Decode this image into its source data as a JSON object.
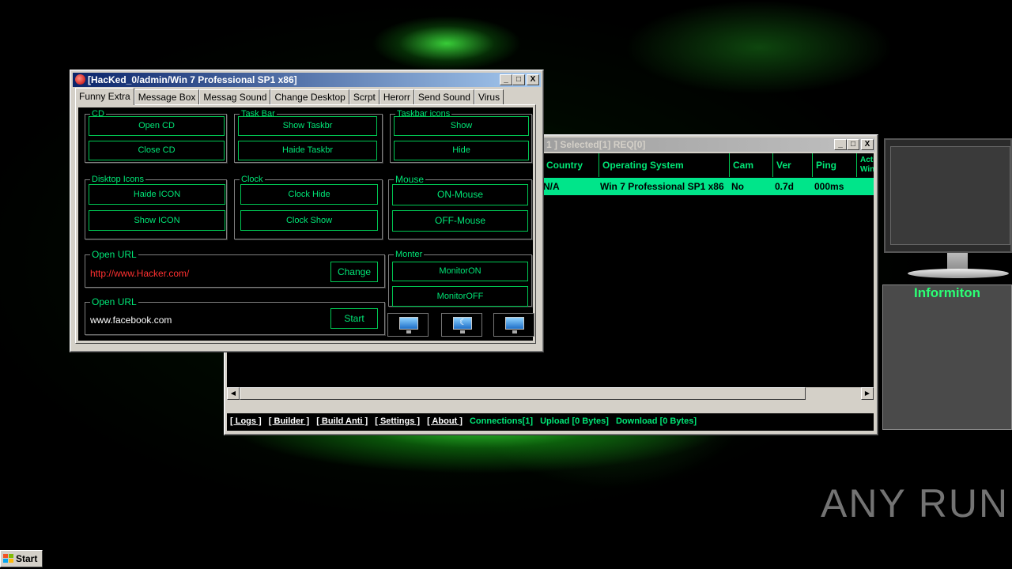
{
  "colors": {
    "accent_green": "#00e676",
    "selected_row": "#00e58a",
    "url_red": "#ff3030"
  },
  "main_window": {
    "title": "[HacKed_0/admin/Win 7 Professional SP1 x86]",
    "buttons": [
      "_",
      "□",
      "X"
    ],
    "tabs": [
      "Funny Extra",
      "Message Box",
      "Messag Sound",
      "Change Desktop",
      "Scrpt",
      "Herorr",
      "Send Sound",
      "Virus"
    ],
    "groups": {
      "cd": {
        "legend": "CD",
        "open": "Open CD",
        "close": "Close CD"
      },
      "taskbar": {
        "legend": "Task Bar",
        "show": "Show Taskbr",
        "hide": "Haide Taskbr"
      },
      "taskbar_icons": {
        "legend": "Taskbar icons",
        "show": "Show",
        "hide": "Hide"
      },
      "desktop_icons": {
        "legend": "Disktop  Icons",
        "hide": "Haide ICON",
        "show": "Show ICON"
      },
      "clock": {
        "legend": "Clock",
        "hide": "Clock Hide",
        "show": "Clock Show"
      },
      "mouse": {
        "legend": "Mouse",
        "on": "ON-Mouse",
        "off": "OFF-Mouse"
      },
      "open_url_1": {
        "legend": "Open URL",
        "url": "http://www.Hacker.com/",
        "button": "Change"
      },
      "open_url_2": {
        "legend": "Open URL",
        "url": "www.facebook.com",
        "button": "Start"
      },
      "monitor": {
        "legend": "Monter",
        "on": "MonitorON",
        "off": "MonitorOFF"
      }
    },
    "icons": [
      "monitor-settings-icon",
      "monitor-sleep-icon",
      "monitor-icon"
    ]
  },
  "list_window": {
    "title_partial": "1 ]   Selected[1] REQ[0]",
    "columns": [
      "Country",
      "Operating System",
      "Cam",
      "Ver",
      "Ping",
      "Acti Win"
    ],
    "rows": [
      {
        "country": "N/A",
        "os": "Win 7 Professional SP1 x86",
        "cam": "No",
        "ver": "0.7d",
        "ping": "000ms"
      }
    ],
    "statusbar": {
      "links": [
        "[ Logs ]",
        "[ Builder ]",
        "[ Build Anti ]",
        "[ Settings ]",
        "[ About ]"
      ],
      "connections": "Connections[1]",
      "upload": "Upload [0 Bytes]",
      "download": "Download [0 Bytes]"
    }
  },
  "info_panel": {
    "title": "Informiton"
  },
  "watermark": "ANY RUN",
  "taskbar": {
    "start": "Start"
  }
}
